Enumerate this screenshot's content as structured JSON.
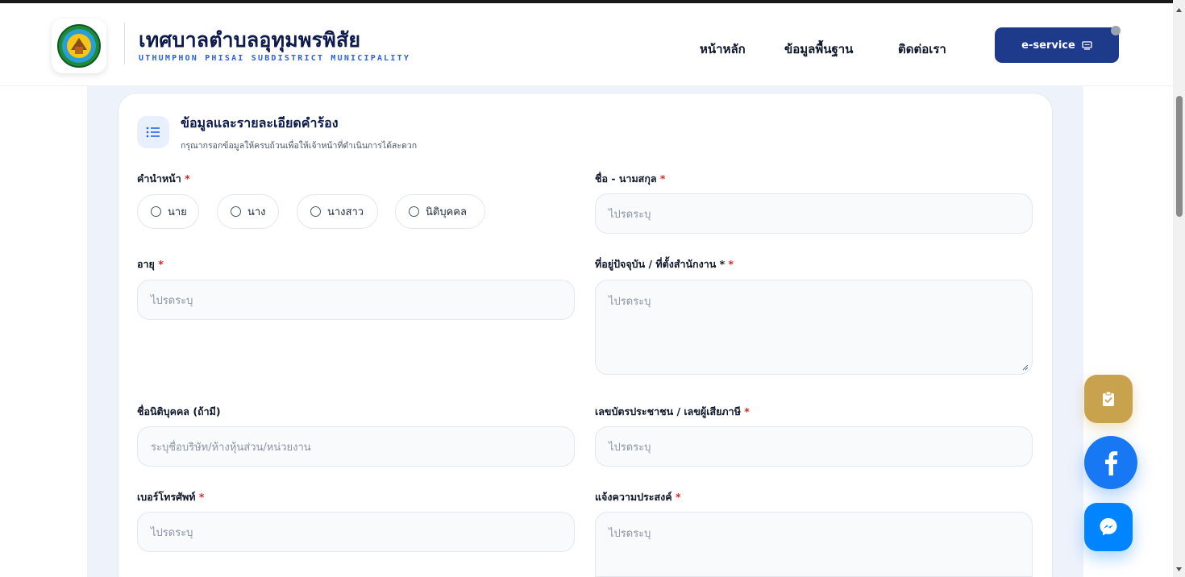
{
  "header": {
    "title": "เทศบาลตำบลอุทุมพรพิสัย",
    "subtitle": "UTHUMPHON PHISAI SUBDISTRICT MUNICIPALITY",
    "nav": {
      "home": "หน้าหลัก",
      "info": "ข้อมูลพื้นฐาน",
      "contact": "ติดต่อเรา"
    },
    "eservice_label": "e-service"
  },
  "section": {
    "title": "ข้อมูลและรายละเอียดคำร้อง",
    "description": "กรุณากรอกข้อมูลให้ครบถ้วนเพื่อให้เจ้าหน้าที่ดำเนินการได้สะดวก"
  },
  "form": {
    "required_mark": "*",
    "prefix": {
      "label": "คำนำหน้า",
      "options": [
        "นาย",
        "นาง",
        "นางสาว",
        "นิติบุคคล"
      ]
    },
    "fullname": {
      "label": "ชื่อ - นามสกุล",
      "placeholder": "ไปรดระบุ"
    },
    "age": {
      "label": "อายุ",
      "placeholder": "ไปรดระบุ"
    },
    "address": {
      "label": "ที่อยู่ปัจจุบัน / ที่ตั้งสำนักงาน *",
      "placeholder": "ไปรดระบุ"
    },
    "company": {
      "label": "ชื่อนิติบุคคล (ถ้ามี)",
      "placeholder": "ระบุชื่อบริษัท/ห้างหุ้นส่วน/หน่วยงาน"
    },
    "id_number": {
      "label": "เลขบัตรประชาชน / เลขผู้เสียภาษี",
      "placeholder": "ไปรดระบุ"
    },
    "phone": {
      "label": "เบอร์โทรศัพท์",
      "placeholder": "ไปรดระบุ"
    },
    "purpose": {
      "label": "แจ้งความประสงค์",
      "placeholder": "ไปรดระบุ"
    }
  },
  "colors": {
    "primary": "#1e3a8a",
    "accent": "#2563eb",
    "required": "#dc2626",
    "tracking": "#c9a24e",
    "facebook": "#1877f2",
    "messenger": "#0084ff"
  },
  "icons": {
    "logo": "municipality-seal-icon",
    "section": "list-icon",
    "eservice": "monitor-icon",
    "tracking": "clipboard-check-icon",
    "facebook": "facebook-icon",
    "messenger": "messenger-icon"
  }
}
